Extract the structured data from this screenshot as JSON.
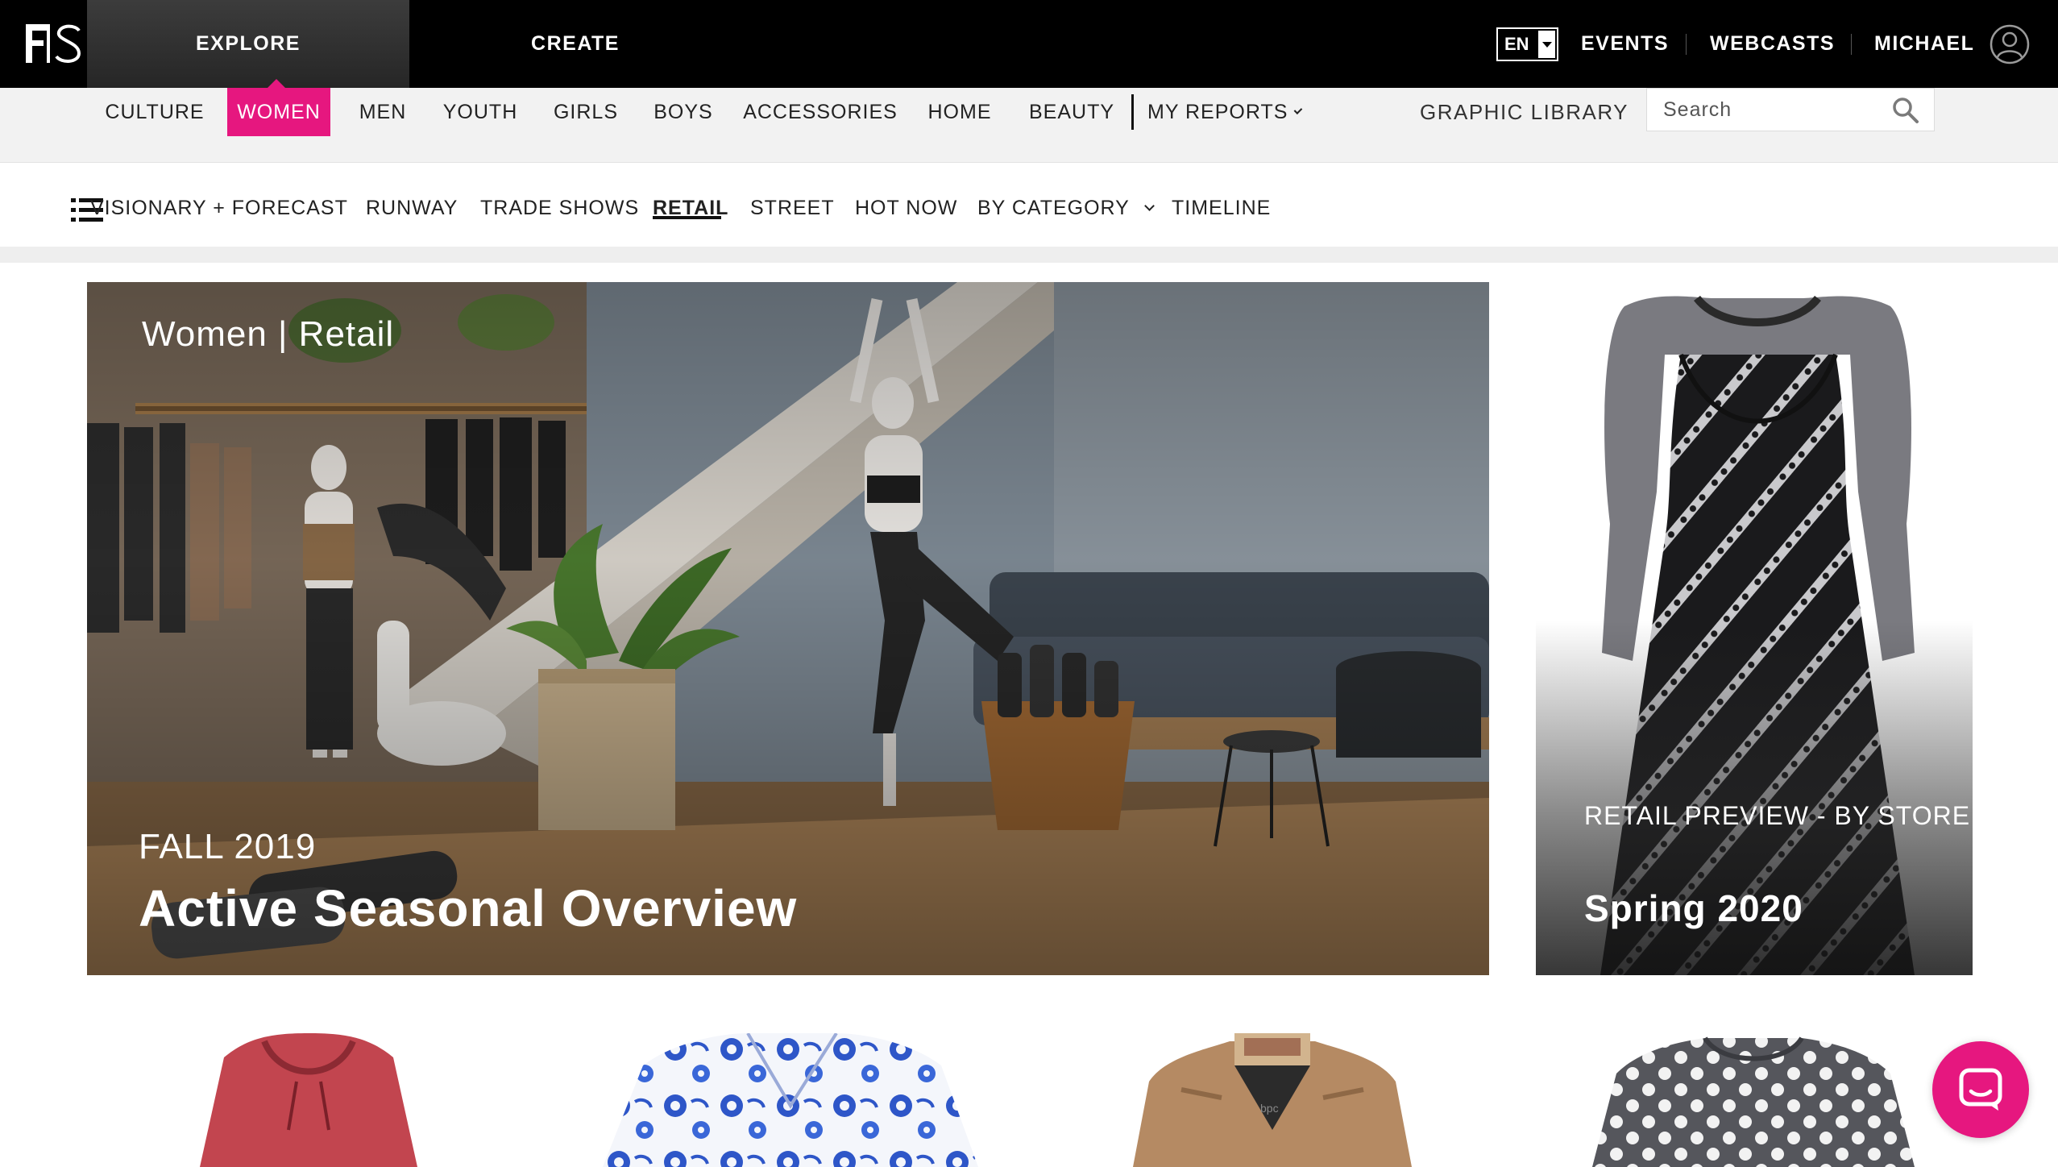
{
  "header": {
    "tabs": [
      {
        "label": "EXPLORE",
        "active": true
      },
      {
        "label": "CREATE",
        "active": false
      }
    ],
    "language": "EN",
    "links": [
      "EVENTS",
      "WEBCASTS",
      "MICHAEL"
    ]
  },
  "categories": {
    "items": [
      "CULTURE",
      "WOMEN",
      "MEN",
      "YOUTH",
      "GIRLS",
      "BOYS",
      "ACCESSORIES",
      "HOME",
      "BEAUTY"
    ],
    "active": "WOMEN",
    "my_reports": "MY REPORTS",
    "graphic_library": "GRAPHIC LIBRARY",
    "search_placeholder": "Search"
  },
  "subnav": {
    "items": [
      "VISIONARY + FORECAST",
      "RUNWAY",
      "TRADE SHOWS",
      "RETAIL",
      "STREET",
      "HOT NOW",
      "BY CATEGORY",
      "TIMELINE"
    ],
    "active": "RETAIL"
  },
  "hero": {
    "kicker": "Women | Retail",
    "season": "FALL 2019",
    "title": "Active Seasonal Overview"
  },
  "side_card": {
    "kicker": "RETAIL PREVIEW - BY STORE",
    "title": "Spring 2020"
  },
  "colors": {
    "accent": "#e6177f",
    "topbar": "#000000",
    "catbar": "#f2f2f2"
  }
}
